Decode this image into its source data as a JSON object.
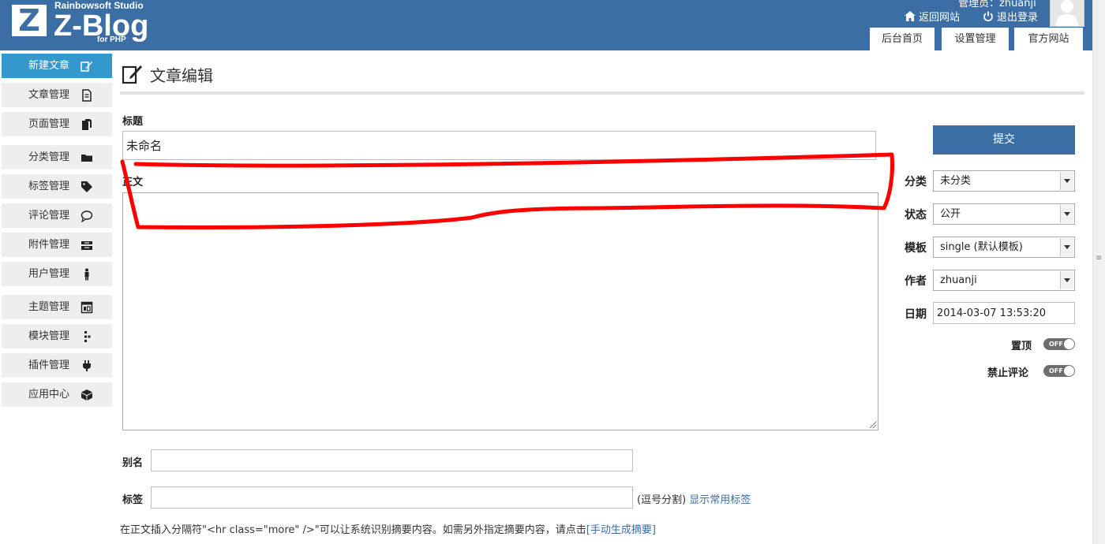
{
  "header": {
    "studio": "Rainbowsoft Studio",
    "logo_letter": "Z",
    "logo_name": "Z-Blog",
    "logo_sub": "for PHP",
    "admin_text": "管理员：zhuanji",
    "back_site": "返回网站",
    "logout": "退出登录",
    "tabs": [
      "后台首页",
      "设置管理",
      "官方网站"
    ]
  },
  "sidebar": {
    "items": [
      {
        "label": "新建文章",
        "icon": "new-article-icon"
      },
      {
        "label": "文章管理",
        "icon": "article-manage-icon"
      },
      {
        "label": "页面管理",
        "icon": "page-manage-icon"
      },
      {
        "label": "分类管理",
        "icon": "folder-icon"
      },
      {
        "label": "标签管理",
        "icon": "tag-icon"
      },
      {
        "label": "评论管理",
        "icon": "comment-icon"
      },
      {
        "label": "附件管理",
        "icon": "attachment-icon"
      },
      {
        "label": "用户管理",
        "icon": "user-icon"
      },
      {
        "label": "主题管理",
        "icon": "theme-icon"
      },
      {
        "label": "模块管理",
        "icon": "module-icon"
      },
      {
        "label": "插件管理",
        "icon": "plugin-icon"
      },
      {
        "label": "应用中心",
        "icon": "app-center-icon"
      }
    ]
  },
  "main": {
    "page_title": "文章编辑",
    "title_label": "标题",
    "title_value": "未命名",
    "body_label": "正文",
    "alias_label": "别名",
    "alias_value": "",
    "tags_label": "标签",
    "tags_value": "",
    "tags_hint": "(逗号分割)",
    "tags_link": "显示常用标签",
    "summary_hint": "在正文插入分隔符\"<hr class=\"more\" />\"可以让系统识别摘要内容。如需另外指定摘要内容，请点击",
    "summary_link": "[手动生成摘要]"
  },
  "side_panel": {
    "submit": "提交",
    "category_label": "分类",
    "category_value": "未分类",
    "status_label": "状态",
    "status_value": "公开",
    "template_label": "模板",
    "template_value": "single (默认模板)",
    "author_label": "作者",
    "author_value": "zhuanji",
    "date_label": "日期",
    "date_value": "2014-03-07 13:53:20",
    "top_label": "置顶",
    "top_state": "OFF",
    "no_comment_label": "禁止评论",
    "no_comment_state": "OFF"
  },
  "colors": {
    "header": "#3a6ea5",
    "active_menu": "#3399cc",
    "annotation": "#ff0000"
  }
}
